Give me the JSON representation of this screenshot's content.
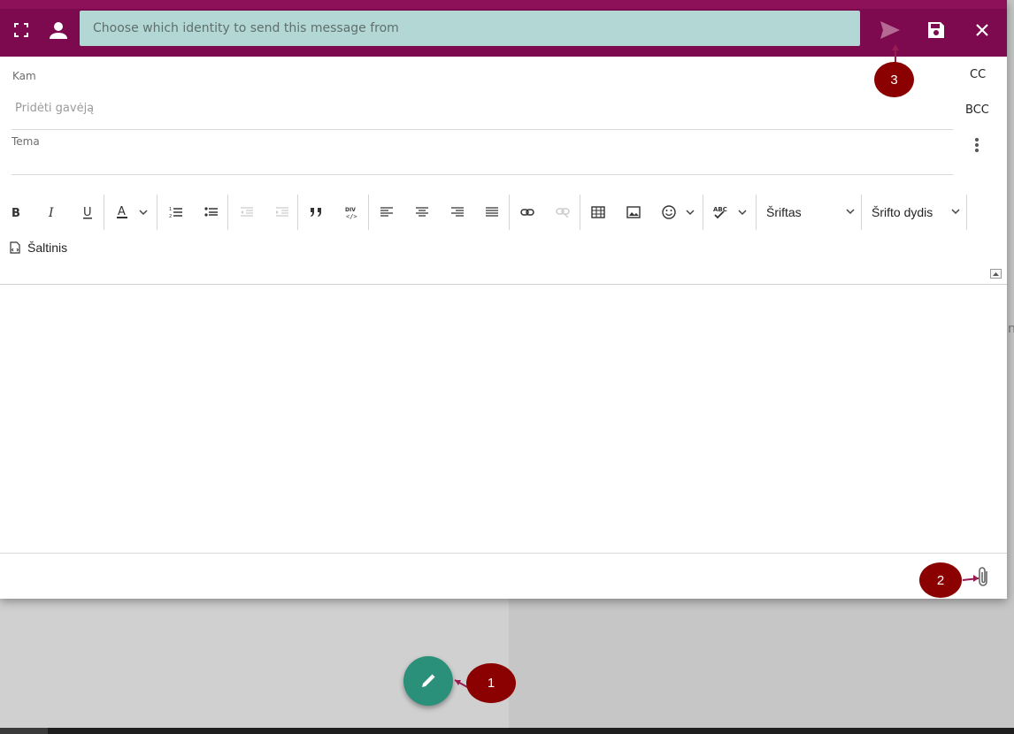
{
  "topbar": {
    "identity_placeholder": "Choose which identity to send this message from"
  },
  "fields": {
    "to_label": "Kam",
    "recipient_placeholder": "Pridėti gavėją",
    "subject_label": "Tema",
    "cc_label": "CC",
    "bcc_label": "BCC"
  },
  "toolbar": {
    "font_family_label": "Šriftas",
    "font_size_label": "Šrifto dydis",
    "source_label": "Šaltinis"
  },
  "annotations": {
    "marker_1": "1",
    "marker_2": "2",
    "marker_3": "3"
  },
  "colors": {
    "topbar": "#7d0a4f",
    "identity_field": "#b3d7d4",
    "fab": "#2a9079",
    "marker": "#8b0000"
  },
  "icons": [
    "fullscreen-icon",
    "identity-person-icon",
    "send-icon",
    "save-icon",
    "close-icon",
    "bold-icon",
    "italic-icon",
    "underline-icon",
    "text-color-icon",
    "numbered-list-icon",
    "bulleted-list-icon",
    "outdent-icon",
    "indent-icon",
    "blockquote-icon",
    "div-icon",
    "align-left-icon",
    "align-center-icon",
    "align-right-icon",
    "justify-icon",
    "link-icon",
    "unlink-icon",
    "table-icon",
    "image-icon",
    "emoji-icon",
    "spellcheck-icon",
    "source-icon",
    "attachment-icon",
    "pencil-icon"
  ]
}
